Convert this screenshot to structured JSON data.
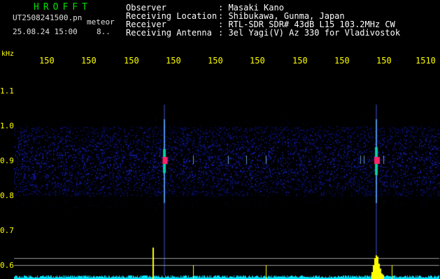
{
  "app": {
    "brand": "HROFFT",
    "filename": "UT2508241500.pn",
    "mode": "meteor",
    "datetime": "25.08.24 15:00",
    "count": "8.."
  },
  "info": {
    "rows": [
      {
        "label": "Observer",
        "value": ": Masaki Kano"
      },
      {
        "label": "Receiving Location",
        "value": ": Shibukawa, Gunma, Japan"
      },
      {
        "label": "Receiver",
        "value": ": RTL-SDR SDR# 43dB L15 103.2MHz CW"
      },
      {
        "label": "Receiving Antenna",
        "value": ": 3el Yagi(V) Az 330 for Vladivostok"
      }
    ]
  },
  "colors": {
    "background": "#000000",
    "text": "#ffffff",
    "brand": "#00e000",
    "axis": "#ffff00",
    "noise": "#1a2bd8",
    "trace": "#00e5ff",
    "peak": "#ffff00",
    "echo_core": "#ff2266"
  },
  "chart_data": {
    "type": "heatmap",
    "title": "",
    "y_unit": "kHz",
    "x_ticks": [
      "150",
      "150",
      "150",
      "150",
      "150",
      "150",
      "150",
      "150",
      "150",
      "1510"
    ],
    "y_ticks": [
      "1.1",
      "1.0",
      "0.9",
      "0.8",
      "0.7",
      "0.6"
    ],
    "ylim": [
      0.55,
      1.15
    ],
    "noise_band": [
      0.8,
      1.0
    ],
    "carrier_khz": 0.9,
    "echoes": [
      {
        "time_frac": 0.352,
        "strength": 0.8
      },
      {
        "time_frac": 0.85,
        "strength": 1.0
      }
    ],
    "spectrum_reference_lines": 2
  }
}
